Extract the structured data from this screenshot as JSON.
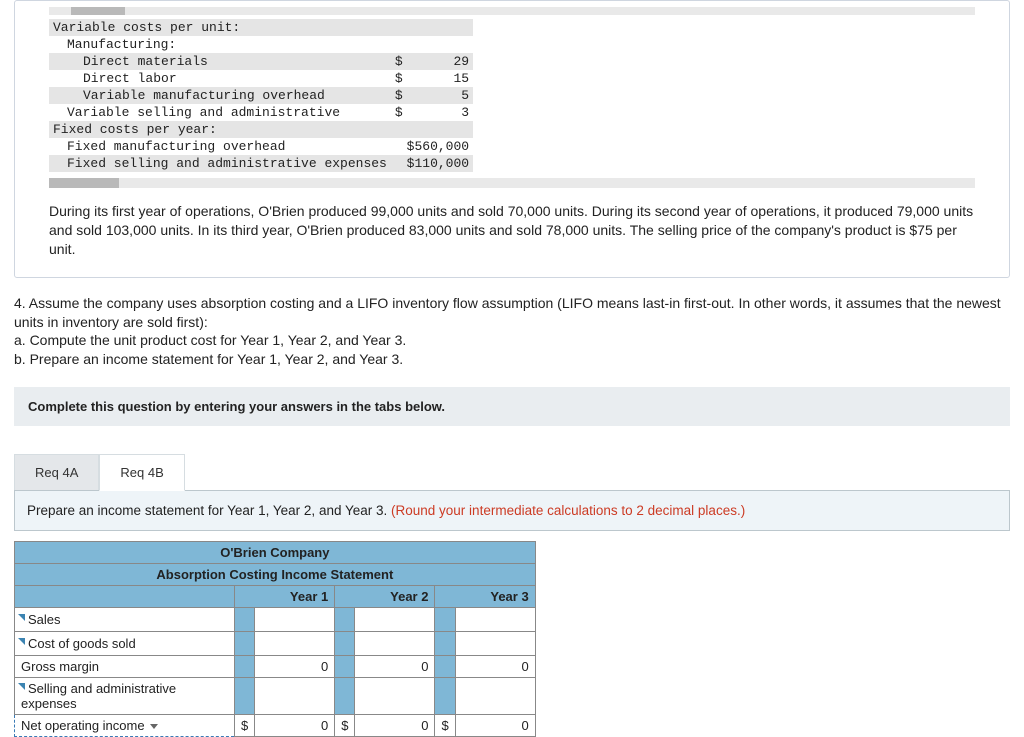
{
  "cost_info": {
    "heading_var": "Variable costs per unit:",
    "heading_mfg": "Manufacturing:",
    "rows": [
      {
        "label": "Direct materials",
        "cur": "$",
        "val": "29",
        "band": true
      },
      {
        "label": "Direct labor",
        "cur": "$",
        "val": "15",
        "band": false
      },
      {
        "label": "Variable manufacturing overhead",
        "cur": "$",
        "val": "5",
        "band": true
      },
      {
        "label": "Variable selling and administrative",
        "cur": "$",
        "val": "3",
        "band": false
      }
    ],
    "heading_fixed": "Fixed costs per year:",
    "fixed_rows": [
      {
        "label": "Fixed manufacturing overhead",
        "val": "$560,000",
        "band": false
      },
      {
        "label": "Fixed selling and administrative expenses",
        "val": "$110,000",
        "band": true
      }
    ]
  },
  "narrative": "During its first year of operations, O'Brien produced 99,000 units and sold 70,000 units. During its second year of operations, it produced 79,000 units and sold 103,000 units. In its third year, O'Brien produced 83,000 units and sold 78,000 units. The selling price of the company's product is $75 per unit.",
  "question": {
    "stem": "4. Assume the company uses absorption costing and a LIFO inventory flow assumption (LIFO means last-in first-out. In other words, it assumes that the newest units in inventory are sold first):",
    "part_a": "a. Compute the unit product cost for Year 1, Year 2, and Year 3.",
    "part_b": "b. Prepare an income statement for Year 1, Year 2, and Year 3."
  },
  "instruction_bar": "Complete this question by entering your answers in the tabs below.",
  "tabs": {
    "a": "Req 4A",
    "b": "Req 4B"
  },
  "tab_instruction_main": "Prepare an income statement for Year 1, Year 2, and Year 3. ",
  "tab_instruction_hint": "(Round your intermediate calculations to 2 decimal places.)",
  "worksheet": {
    "company": "O'Brien Company",
    "title": "Absorption Costing Income Statement",
    "cols": [
      "Year 1",
      "Year 2",
      "Year 3"
    ],
    "rows": [
      {
        "label": "Sales",
        "y1": "",
        "y2": "",
        "y3": ""
      },
      {
        "label": "Cost of goods sold",
        "y1": "",
        "y2": "",
        "y3": ""
      },
      {
        "label": "Gross margin",
        "y1": "0",
        "y2": "0",
        "y3": "0"
      },
      {
        "label": "Selling and administrative expenses",
        "y1": "",
        "y2": "",
        "y3": ""
      },
      {
        "label": "Net operating income",
        "y1": "0",
        "y2": "0",
        "y3": "0",
        "cur": "$"
      }
    ]
  }
}
